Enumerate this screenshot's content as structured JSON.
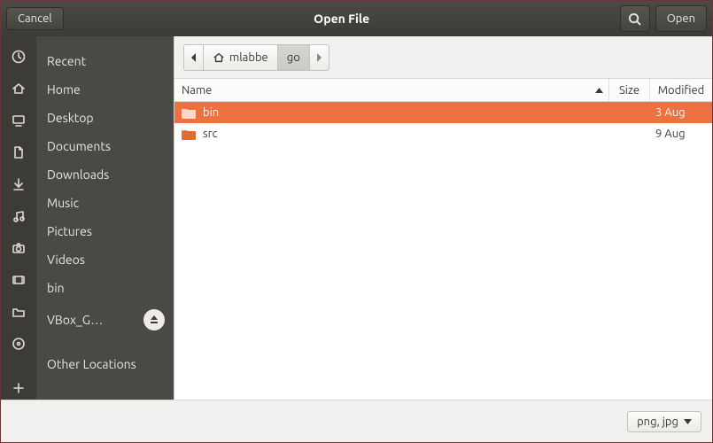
{
  "titlebar": {
    "cancel": "Cancel",
    "title": "Open File",
    "open": "Open"
  },
  "places": [
    {
      "icon": "clock",
      "label": "Recent"
    },
    {
      "icon": "home",
      "label": "Home"
    },
    {
      "icon": "desktop",
      "label": "Desktop"
    },
    {
      "icon": "doc",
      "label": "Documents"
    },
    {
      "icon": "down",
      "label": "Downloads"
    },
    {
      "icon": "music",
      "label": "Music"
    },
    {
      "icon": "camera",
      "label": "Pictures"
    },
    {
      "icon": "video",
      "label": "Videos"
    },
    {
      "icon": "folder",
      "label": "bin"
    },
    {
      "icon": "disc",
      "label": "VBox_G…",
      "eject": true
    },
    {
      "icon": "plus",
      "label": "Other Locations"
    }
  ],
  "pathbar": {
    "crumbs": [
      {
        "label": "mlabbe",
        "icon": "home"
      },
      {
        "label": "go",
        "active": true
      }
    ]
  },
  "columns": {
    "name": "Name",
    "size": "Size",
    "modified": "Modified"
  },
  "files": [
    {
      "name": "bin",
      "modified": "3 Aug",
      "selected": true
    },
    {
      "name": "src",
      "modified": "9 Aug",
      "selected": false
    }
  ],
  "filter": "png, jpg"
}
